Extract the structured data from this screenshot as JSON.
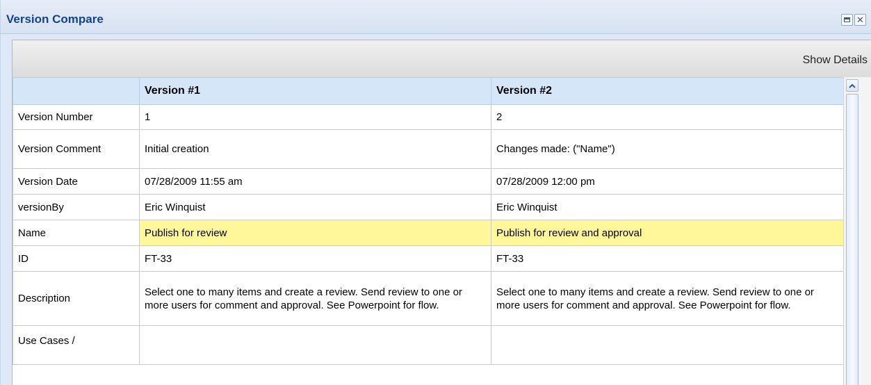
{
  "panel": {
    "title": "Version Compare",
    "maximize_icon": "maximize-icon",
    "close_icon": "close-icon",
    "close_glyph": "✕"
  },
  "toolbar": {
    "show_details_label": "Show Details"
  },
  "table": {
    "columns": [
      "",
      "Version #1",
      "Version #2"
    ],
    "rows": [
      {
        "label": "Version Number",
        "v1": "1",
        "v2": "2",
        "highlight": false
      },
      {
        "label": "Version Comment",
        "v1": "Initial creation",
        "v2": "Changes made: (\"Name\")",
        "highlight": false
      },
      {
        "label": "Version Date",
        "v1": "07/28/2009 11:55 am",
        "v2": "07/28/2009 12:00 pm",
        "highlight": false
      },
      {
        "label": "versionBy",
        "v1": "Eric Winquist",
        "v2": "Eric Winquist",
        "highlight": false
      },
      {
        "label": "Name",
        "v1": "Publish for review",
        "v2": "Publish for review and approval",
        "highlight": true
      },
      {
        "label": "ID",
        "v1": "FT-33",
        "v2": "FT-33",
        "highlight": false
      },
      {
        "label": "Description",
        "v1": "Select one to many items and create a review.  Send review to one or more users for comment and approval.  See Powerpoint for flow.",
        "v2": "Select one to many items and create a review.  Send review to one or more users for comment and approval.  See Powerpoint for flow.",
        "highlight": false
      },
      {
        "label": "Use Cases /",
        "v1": "",
        "v2": "",
        "highlight": false
      }
    ]
  },
  "scrollbar": {
    "up_icon": "scroll-up-icon"
  },
  "colors": {
    "highlight": "#fff79a",
    "header": "#d6e6f9",
    "title_text": "#15428b"
  }
}
